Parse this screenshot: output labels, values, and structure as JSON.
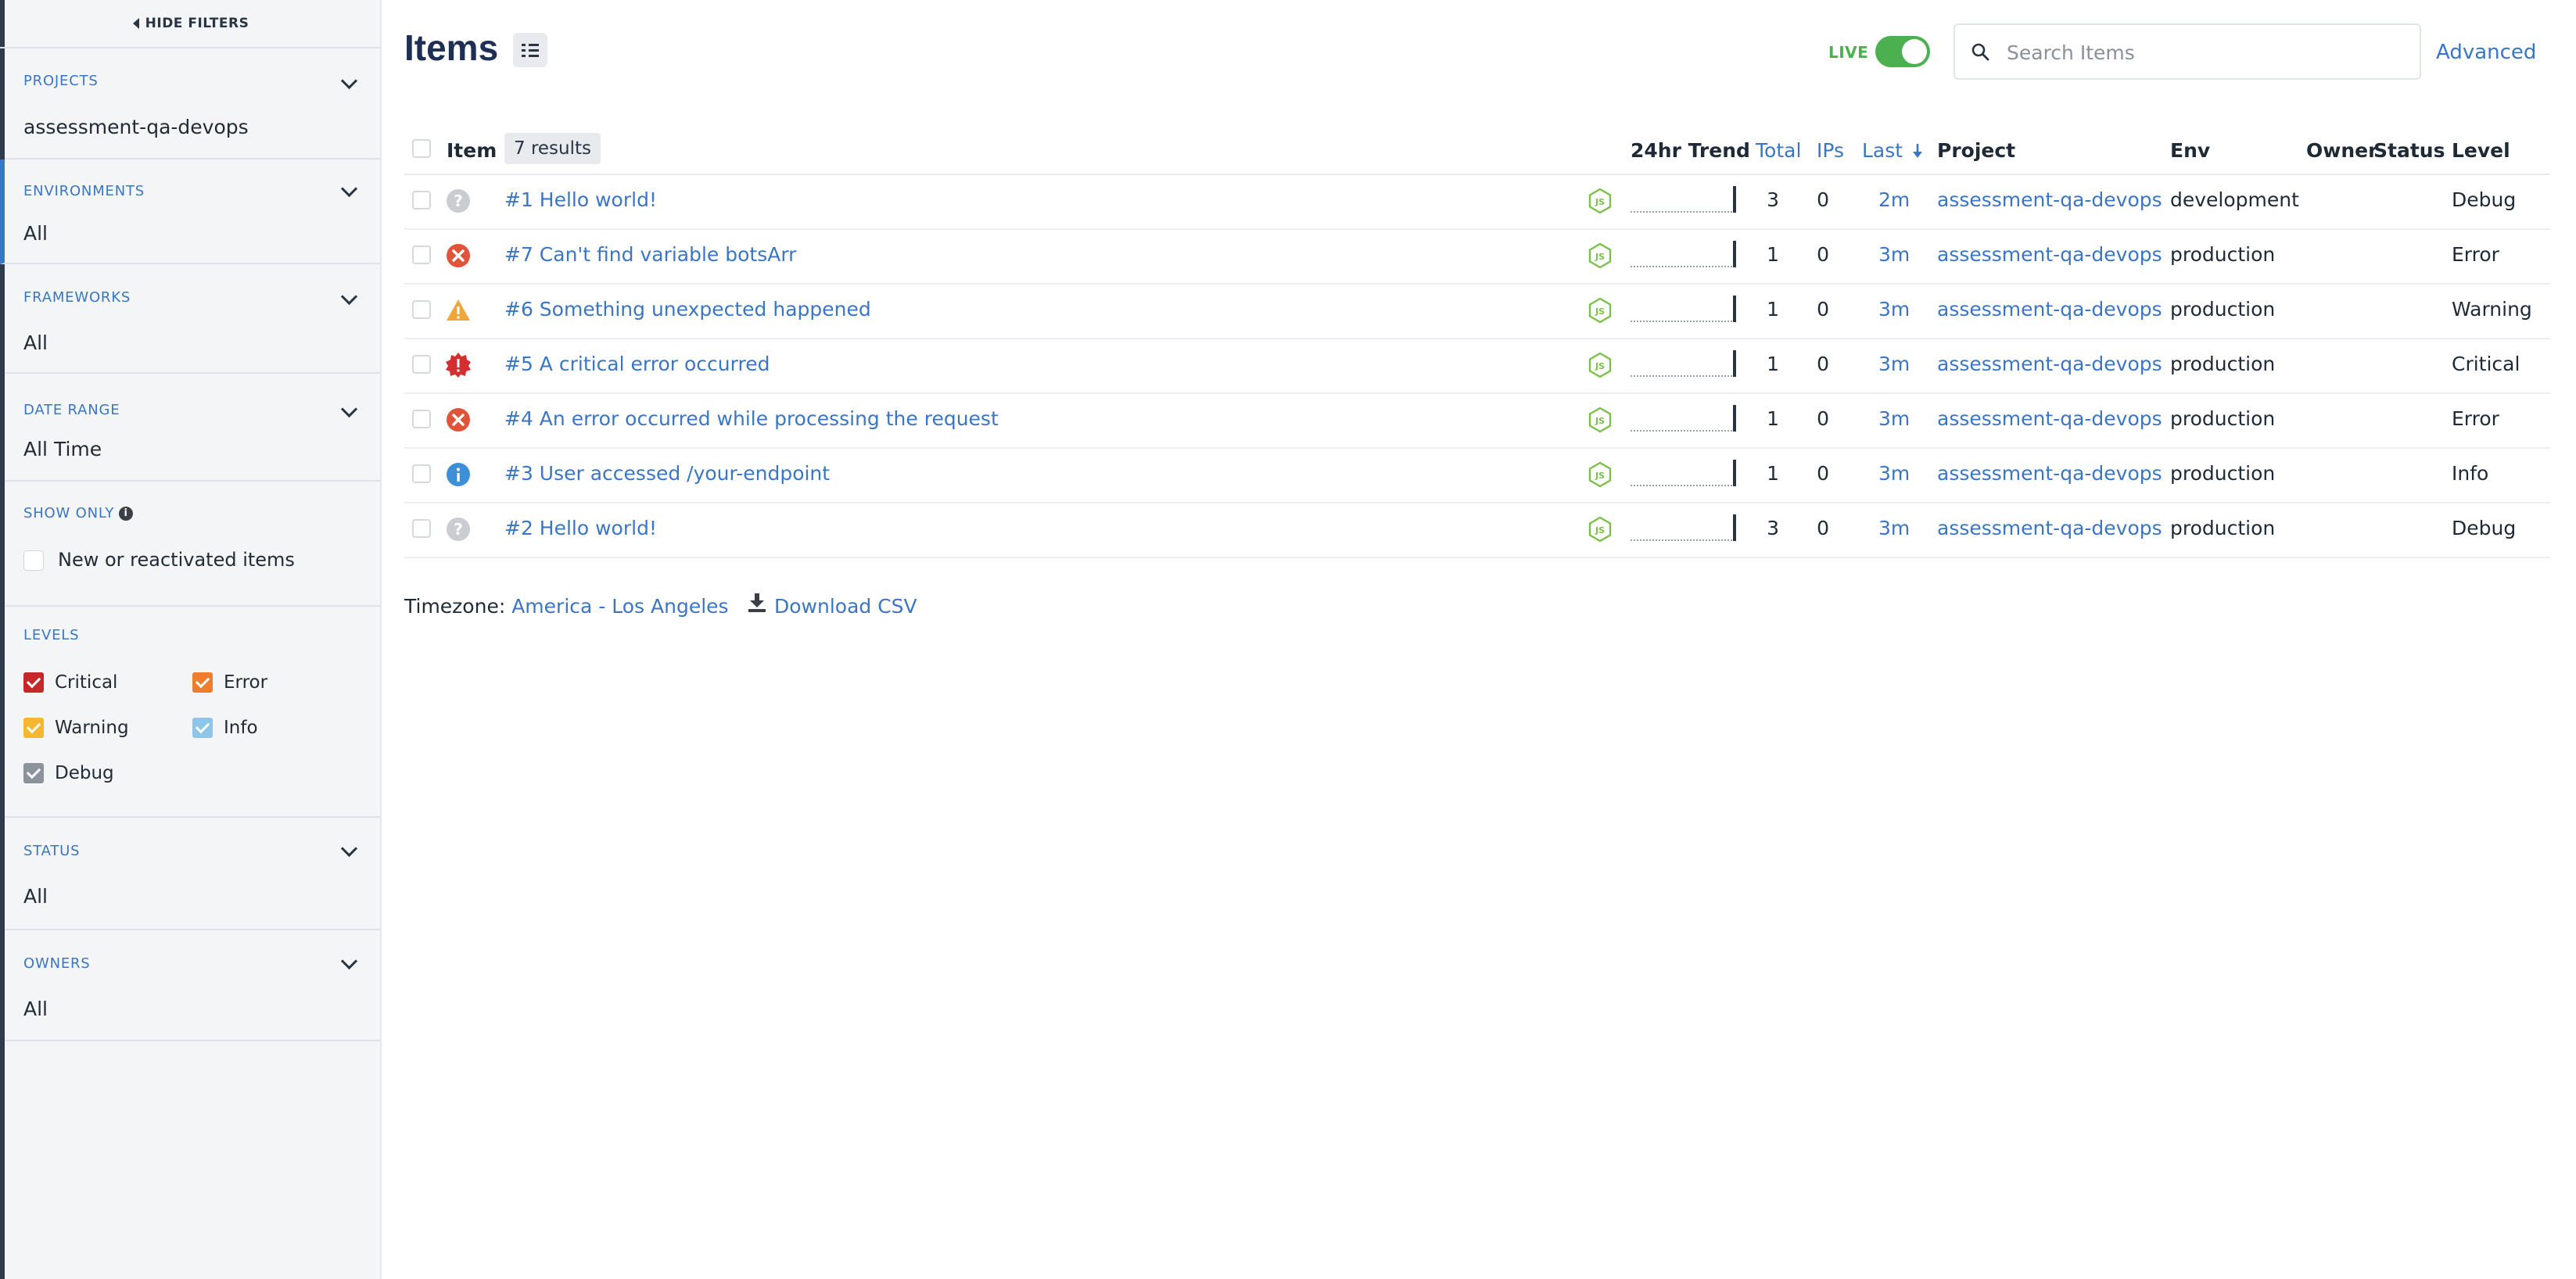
{
  "sidebar": {
    "hide_filters_label": "HIDE FILTERS",
    "projects": {
      "title": "PROJECTS",
      "value": "assessment-qa-devops"
    },
    "environments": {
      "title": "ENVIRONMENTS",
      "value": "All"
    },
    "frameworks": {
      "title": "FRAMEWORKS",
      "value": "All"
    },
    "date_range": {
      "title": "DATE RANGE",
      "value": "All Time"
    },
    "show_only": {
      "title": "SHOW ONLY",
      "info_glyph": "i",
      "option": "New or reactivated items"
    },
    "levels": {
      "title": "LEVELS",
      "items": [
        {
          "label": "Critical",
          "color": "#c62828"
        },
        {
          "label": "Error",
          "color": "#ef7d2e"
        },
        {
          "label": "Warning",
          "color": "#f5b730"
        },
        {
          "label": "Info",
          "color": "#8ec5ea"
        },
        {
          "label": "Debug",
          "color": "#8d939c"
        }
      ]
    },
    "status": {
      "title": "STATUS",
      "value": "All"
    },
    "owners": {
      "title": "OWNERS",
      "value": "All"
    }
  },
  "header": {
    "title": "Items",
    "live_label": "LIVE",
    "live_on": true,
    "search_placeholder": "Search Items",
    "advanced_label": "Advanced"
  },
  "table": {
    "columns": {
      "item": "Item",
      "results": "7 results",
      "trend": "24hr Trend",
      "total": "Total",
      "ips": "IPs",
      "last": "Last",
      "project": "Project",
      "env": "Env",
      "owner": "Owner",
      "status": "Status",
      "level": "Level"
    },
    "rows": [
      {
        "level_icon": "debug-icon",
        "title": "#1 Hello world!",
        "total": "3",
        "ips": "0",
        "last": "2m",
        "project": "assessment-qa-devops",
        "env": "development",
        "owner": "",
        "status": "",
        "level": "Debug"
      },
      {
        "level_icon": "error-icon",
        "title": "#7 Can't find variable botsArr",
        "total": "1",
        "ips": "0",
        "last": "3m",
        "project": "assessment-qa-devops",
        "env": "production",
        "owner": "",
        "status": "",
        "level": "Error"
      },
      {
        "level_icon": "warning-icon",
        "title": "#6 Something unexpected happened",
        "total": "1",
        "ips": "0",
        "last": "3m",
        "project": "assessment-qa-devops",
        "env": "production",
        "owner": "",
        "status": "",
        "level": "Warning"
      },
      {
        "level_icon": "critical-icon",
        "title": "#5 A critical error occurred",
        "total": "1",
        "ips": "0",
        "last": "3m",
        "project": "assessment-qa-devops",
        "env": "production",
        "owner": "",
        "status": "",
        "level": "Critical"
      },
      {
        "level_icon": "error-icon",
        "title": "#4 An error occurred while processing the request",
        "total": "1",
        "ips": "0",
        "last": "3m",
        "project": "assessment-qa-devops",
        "env": "production",
        "owner": "",
        "status": "",
        "level": "Error"
      },
      {
        "level_icon": "info-icon",
        "title": "#3 User accessed /your-endpoint",
        "total": "1",
        "ips": "0",
        "last": "3m",
        "project": "assessment-qa-devops",
        "env": "production",
        "owner": "",
        "status": "",
        "level": "Info"
      },
      {
        "level_icon": "debug-icon",
        "title": "#2 Hello world!",
        "total": "3",
        "ips": "0",
        "last": "3m",
        "project": "assessment-qa-devops",
        "env": "production",
        "owner": "",
        "status": "",
        "level": "Debug"
      }
    ]
  },
  "footer": {
    "timezone_label": "Timezone:",
    "timezone_value": "America - Los Angeles",
    "download_label": "Download CSV"
  },
  "colors": {
    "accent": "#3a76c4",
    "title": "#1d2f55",
    "live": "#4caf50",
    "framework_js": "#7cc04b"
  }
}
